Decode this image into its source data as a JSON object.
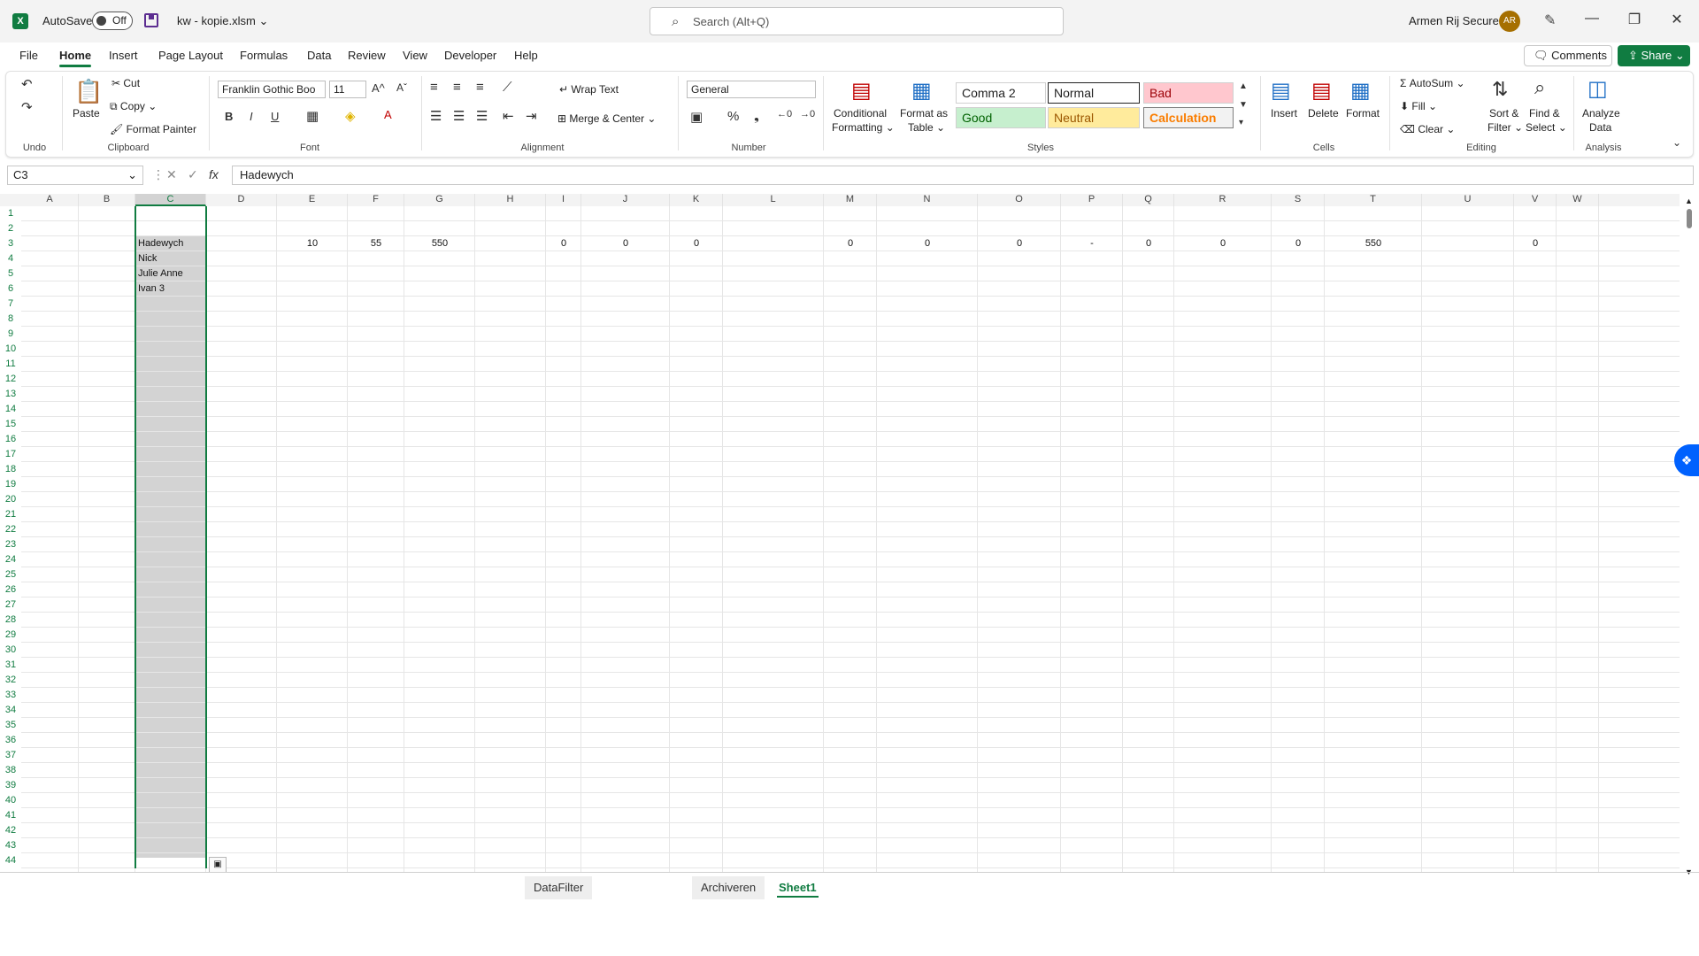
{
  "titlebar": {
    "autosave_label": "AutoSave",
    "autosave_state": "Off",
    "filename": "kw - kopie.xlsm",
    "search_placeholder": "Search (Alt+Q)",
    "user_name": "Armen Rij Secure",
    "user_initials": "AR"
  },
  "menu": [
    "File",
    "Home",
    "Insert",
    "Page Layout",
    "Formulas",
    "Data",
    "Review",
    "View",
    "Developer",
    "Help"
  ],
  "menu_active": "Home",
  "actions": {
    "comments": "Comments",
    "share": "Share"
  },
  "ribbon": {
    "undo": {
      "group": "Undo"
    },
    "clipboard": {
      "group": "Clipboard",
      "paste": "Paste",
      "cut": "Cut",
      "copy": "Copy",
      "format_painter": "Format Painter"
    },
    "font": {
      "group": "Font",
      "family": "Franklin Gothic Boo",
      "size": "11"
    },
    "alignment": {
      "group": "Alignment",
      "wrap_text": "Wrap Text",
      "merge_center": "Merge & Center"
    },
    "number": {
      "group": "Number",
      "format": "General"
    },
    "styles": {
      "group": "Styles",
      "conditional_formatting_1": "Conditional",
      "conditional_formatting_2": "Formatting",
      "format_as_table_1": "Format as",
      "format_as_table_2": "Table",
      "cells": [
        {
          "label": "Comma 2",
          "bg": "#ffffff",
          "color": "#222222"
        },
        {
          "label": "Normal",
          "bg": "#ffffff",
          "color": "#222222"
        },
        {
          "label": "Bad",
          "bg": "#ffc7ce",
          "color": "#9c0006"
        },
        {
          "label": "Good",
          "bg": "#c6efce",
          "color": "#006100"
        },
        {
          "label": "Neutral",
          "bg": "#ffeb9c",
          "color": "#9c5700"
        },
        {
          "label": "Calculation",
          "bg": "#f2f2f2",
          "color": "#fa7d00"
        }
      ]
    },
    "cells": {
      "group": "Cells",
      "insert": "Insert",
      "delete": "Delete",
      "format": "Format"
    },
    "editing": {
      "group": "Editing",
      "autosum": "AutoSum",
      "fill": "Fill",
      "clear": "Clear",
      "sort_filter_1": "Sort &",
      "sort_filter_2": "Filter",
      "find_select_1": "Find &",
      "find_select_2": "Select"
    },
    "analysis": {
      "group": "Analysis",
      "analyze_1": "Analyze",
      "analyze_2": "Data"
    }
  },
  "formula_bar": {
    "name_box": "C3",
    "fx": "fx",
    "content": "Hadewych"
  },
  "columns": [
    "A",
    "B",
    "C",
    "D",
    "E",
    "F",
    "G",
    "H",
    "I",
    "J",
    "K",
    "L",
    "M",
    "N",
    "O",
    "P",
    "Q",
    "R",
    "S",
    "T",
    "U",
    "V",
    "W"
  ],
  "selected_column": "C",
  "row_count": 44,
  "selected_rows": [
    3,
    4,
    5,
    6
  ],
  "cells": {
    "C3": "Hadewych",
    "C4": "Nick",
    "C5": "Julie Anne",
    "C6": "Ivan 3",
    "E3": "10",
    "F3": "55",
    "G3": "550",
    "I3": "0",
    "J3": "0",
    "K3": "0",
    "M3": "0",
    "N3": "0",
    "O3": "0",
    "P3": "-",
    "Q3": "0",
    "R3": "0",
    "S3": "0",
    "T3": "550",
    "V3": "0"
  },
  "sheets": [
    {
      "name": "DataFilter",
      "active": false
    },
    {
      "name": "Archiveren",
      "active": false
    },
    {
      "name": "Sheet1",
      "active": true
    }
  ],
  "colors": {
    "accent": "#107c41",
    "selection": "#d3d3d3"
  }
}
